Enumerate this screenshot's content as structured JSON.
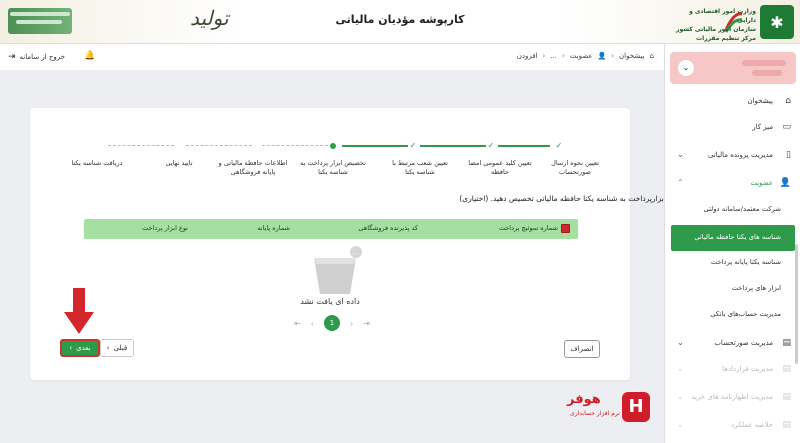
{
  "header": {
    "title": "کارپوشه مؤدیان مالیاتی",
    "tolid_text": "تولید",
    "org_name_line1": "وزارت امور اقتصادی و دارایی",
    "org_name_line2": "سازمان امور مالیاتی کشور",
    "org_name_line3": "مرکز تنظیم مقررات"
  },
  "toolbar": {
    "logout_label": "خروج از سامانه",
    "breadcrumb": [
      "پیشخوان",
      "عضویت",
      "...",
      "افزودن"
    ]
  },
  "stepper": {
    "steps": [
      {
        "label": "تعیین نحوه ارسال صورتحساب",
        "state": "done"
      },
      {
        "label": "تعیین کلید عمومی امضا حافظه",
        "state": "done"
      },
      {
        "label": "تعیین شعب مرتبط با شناسه یکتا",
        "state": "done"
      },
      {
        "label": "تخصیص ابزار پرداخت به شناسه یکتا",
        "state": "current"
      },
      {
        "label": "اطلاعات حافظه مالیاتی و پایانه فروشگاهی",
        "state": "todo"
      },
      {
        "label": "تایید نهایی",
        "state": "todo"
      },
      {
        "label": "دریافت شناسه یکتا",
        "state": "todo"
      }
    ]
  },
  "main": {
    "instruction": "لطفا یک یا چند ابزارپرداخت به شناسه یکتا حافظه مالیاتی تخصیص دهید. (اختیاری)",
    "table_headers": [
      "شماره سوئیچ پرداخت",
      "کد پذیرنده فروشگاهی",
      "شماره پایانه",
      "نوع ابزار پرداخت"
    ],
    "empty_text": "داده ای یافت نشد",
    "current_page": "1"
  },
  "buttons": {
    "next": "بعدی",
    "prev": "قبلی",
    "cancel": "انصراف"
  },
  "brand": {
    "name": "هوفر",
    "subtitle": "نرم افزار حسابداری"
  },
  "sidebar": {
    "items": [
      {
        "label": "پیشخوان",
        "icon": "home-icon"
      },
      {
        "label": "میز کار",
        "icon": "desk-icon"
      },
      {
        "label": "مدیریت پرونده مالیاتی",
        "icon": "file-icon"
      },
      {
        "label": "عضویت",
        "icon": "user-icon"
      }
    ],
    "sub_items": [
      "شرکت معتمد/سامانه دولتی",
      "شناسه های یکتا حافظه مالیاتی",
      "شناسه یکتا پایانه پرداخت",
      "ابزار های پرداخت",
      "مدیریت حساب‌های بانکی"
    ],
    "more_items": [
      {
        "label": "مدیریت صورتحساب",
        "icon": "invoice-icon"
      },
      {
        "label": "مدیریت قراردادها",
        "icon": "contract-icon"
      },
      {
        "label": "مدیریت اظهارنامه های خرید",
        "icon": "declaration-icon"
      },
      {
        "label": "خلاصه عملکرد",
        "icon": "summary-icon"
      }
    ]
  },
  "colors": {
    "accent_green": "#2e9b4a",
    "table_header_green": "#a5dfa2",
    "alert_red": "#d3272c"
  }
}
